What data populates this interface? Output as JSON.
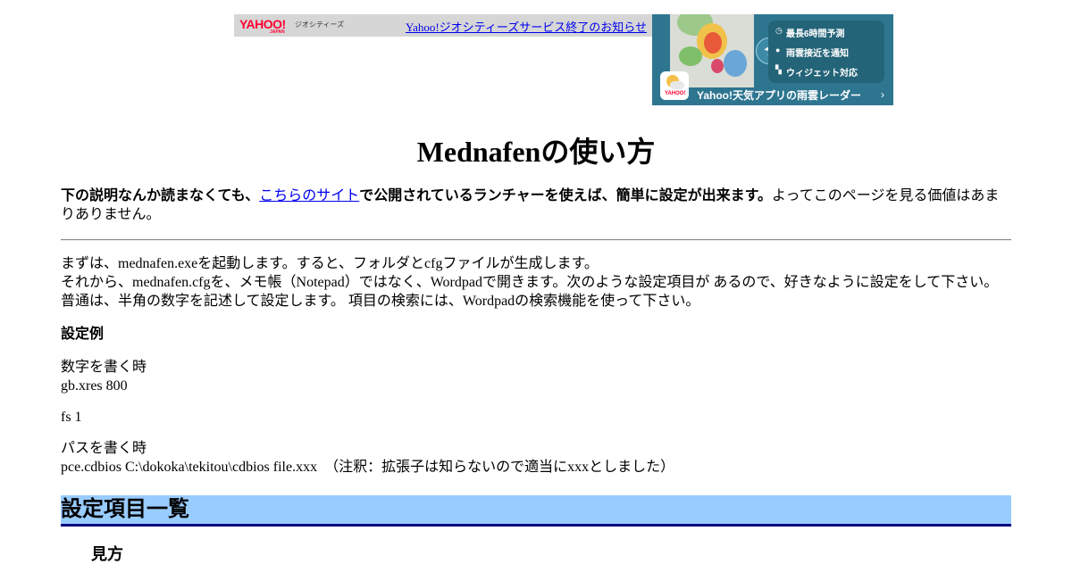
{
  "geocities_bar": {
    "logo_text": "YAHOO!",
    "logo_sub": "JAPAN",
    "brand_text": "ジオシティーズ",
    "notice_link": "Yahoo!ジオシティーズサービス終了のお知らせ"
  },
  "ad": {
    "features": [
      "最長6時間予測",
      "雨雲接近を通知",
      "ウィジェット対応"
    ],
    "app_logo": "YAHOO!",
    "banner_text": "Yahoo!天気アプリの雨雲レーダー",
    "chevron": "›",
    "colors": {
      "background": "#2e7690",
      "panel": "#246478"
    }
  },
  "page": {
    "title": "Mednafenの使い方",
    "intro_bold_before": "下の説明なんか読まなくても、",
    "intro_link": "こちらのサイト",
    "intro_bold_after": "で公開されているランチャーを使えば、簡単に設定が出来ます。",
    "intro_rest": "よってこのページを見る価値はあまりありません。",
    "instructions": [
      "まずは、mednafen.exeを起動します。すると、フォルダとcfgファイルが生成します。",
      "それから、mednafen.cfgを、メモ帳（Notepad）ではなく、Wordpadで開きます。次のような設定項目が あるので、好きなように設定をして下さい。",
      "普通は、半角の数字を記述して設定します。 項目の検索には、Wordpadの検索機能を使って下さい。"
    ],
    "example_heading": "設定例",
    "number_label": "数字を書く時",
    "number_example": "gb.xres 800",
    "fs_example": "fs 1",
    "path_label": "パスを書く時",
    "path_example": "pce.cdbios C:\\dokoka\\tekitou\\cdbios file.xxx　（注釈：拡張子は知らないので適当にxxxとしました）",
    "section_heading": "設定項目一覧",
    "sub_heading": "見方",
    "colors": {
      "section_bg": "#99ccff",
      "section_border": "#000080",
      "link": "#0000ee"
    }
  }
}
